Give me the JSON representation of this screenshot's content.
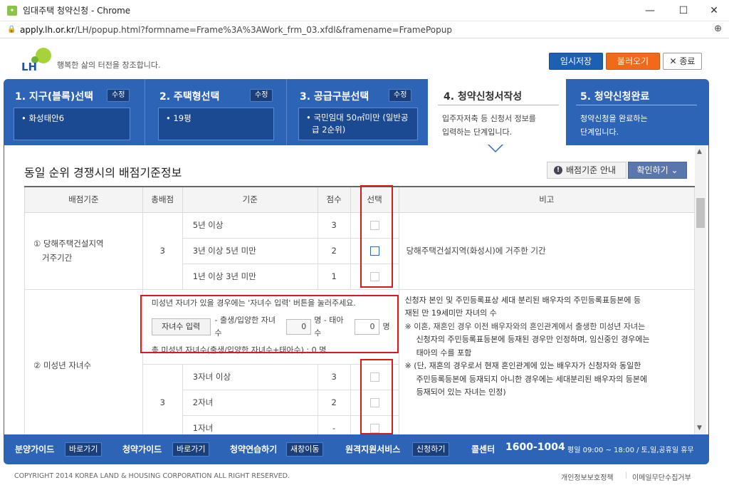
{
  "window": {
    "title": "임대주택 청약신청 - Chrome",
    "url_host": "apply.lh.or.kr",
    "url_path": "/LH/popup.html?formname=Frame%3A%3AWork_frm_03.xfdl&framename=FramePopup",
    "minimize": "—",
    "maximize": "☐",
    "close": "✕"
  },
  "header": {
    "logo_text": "LH",
    "slogan": "행복한 삶의 터전을 창조합니다.",
    "save_label": "임시저장",
    "load_label": "불러오기",
    "close_label": "✕ 종료"
  },
  "steps": [
    {
      "title": "1. 지구(블록)선택",
      "edit": "수정",
      "value": "• 화성태안6"
    },
    {
      "title": "2. 주택형선택",
      "edit": "수정",
      "value": "• 19평"
    },
    {
      "title": "3. 공급구분선택",
      "edit": "수정",
      "value_line1": "• 국민임대 50㎡미만 (일반공",
      "value_line2": "급 2순위)"
    },
    {
      "title": "4. 청약신청서작성",
      "desc_line1": "입주자저축 등 신청서 정보를",
      "desc_line2": "입력하는 단계입니다."
    },
    {
      "title": "5. 청약신청완료",
      "desc_line1": "청약신청을 완료하는",
      "desc_line2": "단계입니다."
    }
  ],
  "section": {
    "title": "동일 순위 경쟁시의 배점기준정보",
    "guide_label": "배점기준 안내",
    "confirm_label": "확인하기 ⌄"
  },
  "table": {
    "headers": [
      "배점기준",
      "총배점",
      "기준",
      "점수",
      "선택",
      "비고"
    ],
    "cat1": {
      "label_line1": "① 당해주택건설지역",
      "label_line2": "거주기간",
      "total": "3",
      "rows": [
        {
          "criteria": "5년 이상",
          "score": "3",
          "selected": false
        },
        {
          "criteria": "3년 이상 5년 미만",
          "score": "2",
          "selected": true
        },
        {
          "criteria": "1년 이상 3년 미만",
          "score": "1",
          "selected": false
        }
      ],
      "remark": "당해주택건설지역(화성시)에 거주한 기간"
    },
    "cat2": {
      "label": "② 미성년 자녀수",
      "total": "3",
      "instruction": "미성년 자녀가 있을 경우에는 '자녀수 입력' 버튼을 눌러주세요.",
      "child_button": "자녀수 입력",
      "born_label": "- 출생/입양한 자녀수",
      "born_value": "0",
      "unit1": "명 - 태아수",
      "fetus_value": "0",
      "unit2": "명",
      "total_line": "총 미성년 자녀수(출생/입양한 자녀수+태아수) : 0 명",
      "rows": [
        {
          "criteria": "3자녀 이상",
          "score": "3",
          "selected": false
        },
        {
          "criteria": "2자녀",
          "score": "2",
          "selected": false
        },
        {
          "criteria": "1자녀",
          "score": "-",
          "selected": false
        }
      ],
      "remark_line1": "신청자 본인 및 주민등록표상 세대 분리된 배우자의 주민등록표등본에 등",
      "remark_line2": "재된 만 19세미만 자녀의 수",
      "remark_note1_line1": "※ 이혼, 재혼인 경우 이전 배우자와의 혼인관계에서 출생한 미성년 자녀는",
      "remark_note1_line2": "신청자의 주민등록표등본에 등재된 경우만 인정하며, 임신중인 경우에는",
      "remark_note1_line3": "태아의 수를 포함",
      "remark_note2_line1": "※ (단, 재혼의 경우로서 현재 혼인관계에 있는 배우자가 신청자와 동일한",
      "remark_note2_line2": "주민등록등본에 등재되지 아니한 경우에는 세대분리된 배우자의 등본에",
      "remark_note2_line3": "등재되어 있는 자녀는 인정)"
    }
  },
  "footer": {
    "guide1": "분양가이드",
    "guide1_btn": "바로가기",
    "guide2": "청약가이드",
    "guide2_btn": "바로가기",
    "practice": "청약연습하기",
    "practice_btn": "새창이동",
    "remote": "원격지원서비스",
    "remote_btn": "신청하기",
    "callcenter": "콜센터",
    "phone": "1600-1004",
    "hours": "평일 09:00 ~ 18:00 / 토,일,공휴일 휴무",
    "copyright": "COPYRIGHT 2014 KOREA LAND & HOUSING CORPORATION ALL RIGHT RESERVED.",
    "privacy": "개인정보보호정책",
    "email": "이메일무단수집거부"
  },
  "colors": {
    "brand_blue": "#2e64b5",
    "highlight_red": "#d71a1a",
    "save_blue": "#1d5fb3",
    "load_orange": "#f06a1a"
  }
}
